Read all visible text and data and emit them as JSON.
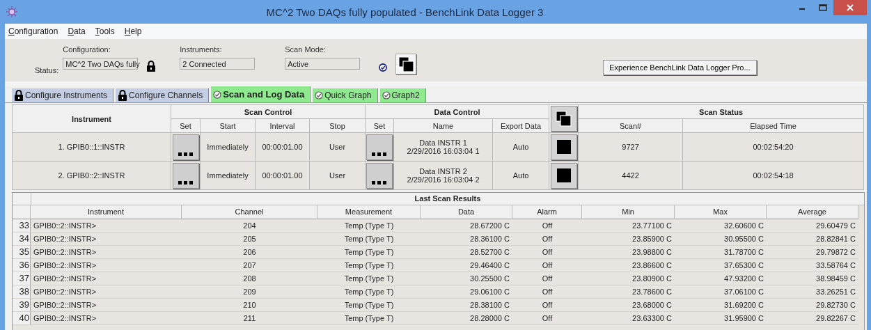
{
  "window": {
    "title": "MC^2 Two DAQs fully populated - BenchLink Data Logger 3"
  },
  "menu": [
    "Configuration",
    "Data",
    "Tools",
    "Help"
  ],
  "status_panel": {
    "configuration_label": "Configuration:",
    "status_label": "Status:",
    "configuration_value": "MC^2 Two DAQs fully",
    "instruments_label": "Instruments:",
    "instruments_value": "2 Connected",
    "scan_mode_label": "Scan Mode:",
    "scan_mode_value": "Active"
  },
  "pro_button": "Experience BenchLink Data Logger Pro...",
  "tabs": [
    {
      "label": "Configure Instruments",
      "locked": true,
      "selected": false
    },
    {
      "label": "Configure Channels",
      "locked": true,
      "selected": false
    },
    {
      "label": "Scan and Log Data",
      "locked": false,
      "selected": true
    },
    {
      "label": "Quick Graph",
      "locked": false,
      "selected": false
    },
    {
      "label": "Graph2",
      "locked": false,
      "selected": false
    }
  ],
  "scan_table": {
    "instrument_header": "Instrument",
    "groups": [
      "Scan Control",
      "Data Control",
      "Scan Status"
    ],
    "columns": [
      "Set",
      "Start",
      "Interval",
      "Stop",
      "Set",
      "Name",
      "Export Data",
      "Scan#",
      "Elapsed Time"
    ],
    "rows": [
      {
        "instrument": "1. GPIB0::1::INSTR",
        "start": "Immediately",
        "interval": "00:00:01.00",
        "stop": "User",
        "name": [
          "Data INSTR 1",
          "2/29/2016 16:03:04 1"
        ],
        "export": "Auto",
        "scan": "9727",
        "elapsed": "00:02:54:20"
      },
      {
        "instrument": "2. GPIB0::2::INSTR",
        "start": "Immediately",
        "interval": "00:00:01.00",
        "stop": "User",
        "name": [
          "Data INSTR 2",
          "2/29/2016 16:03:04 2"
        ],
        "export": "Auto",
        "scan": "4422",
        "elapsed": "00:02:54:18"
      }
    ]
  },
  "results": {
    "title": "Last Scan Results",
    "columns": [
      "Instrument",
      "Channel",
      "Measurement",
      "Data",
      "Alarm",
      "Min",
      "Max",
      "Average"
    ],
    "rows": [
      {
        "index": "33",
        "cells": [
          "GPIB0::2::INSTR>",
          "204",
          "Temp (Type T)",
          "28.67200 C",
          "Off",
          "23.77100 C",
          "32.60600 C",
          "29.60479 C"
        ]
      },
      {
        "index": "34",
        "cells": [
          "GPIB0::2::INSTR>",
          "205",
          "Temp (Type T)",
          "28.36100 C",
          "Off",
          "23.85900 C",
          "30.95500 C",
          "28.82841 C"
        ]
      },
      {
        "index": "35",
        "cells": [
          "GPIB0::2::INSTR>",
          "206",
          "Temp (Type T)",
          "28.52700 C",
          "Off",
          "23.98800 C",
          "31.78700 C",
          "29.79872 C"
        ]
      },
      {
        "index": "36",
        "cells": [
          "GPIB0::2::INSTR>",
          "207",
          "Temp (Type T)",
          "29.46400 C",
          "Off",
          "23.86600 C",
          "37.65300 C",
          "33.58764 C"
        ]
      },
      {
        "index": "37",
        "cells": [
          "GPIB0::2::INSTR>",
          "208",
          "Temp (Type T)",
          "30.25500 C",
          "Off",
          "23.80900 C",
          "47.93200 C",
          "38.98459 C"
        ]
      },
      {
        "index": "38",
        "cells": [
          "GPIB0::2::INSTR>",
          "209",
          "Temp (Type T)",
          "29.06100 C",
          "Off",
          "23.78600 C",
          "37.06100 C",
          "33.26251 C"
        ]
      },
      {
        "index": "39",
        "cells": [
          "GPIB0::2::INSTR>",
          "210",
          "Temp (Type T)",
          "28.38100 C",
          "Off",
          "23.68000 C",
          "31.69200 C",
          "29.82730 C"
        ]
      },
      {
        "index": "40",
        "cells": [
          "GPIB0::2::INSTR>",
          "211",
          "Temp (Type T)",
          "28.28000 C",
          "Off",
          "23.63300 C",
          "31.95900 C",
          "29.82267 C"
        ]
      }
    ]
  }
}
